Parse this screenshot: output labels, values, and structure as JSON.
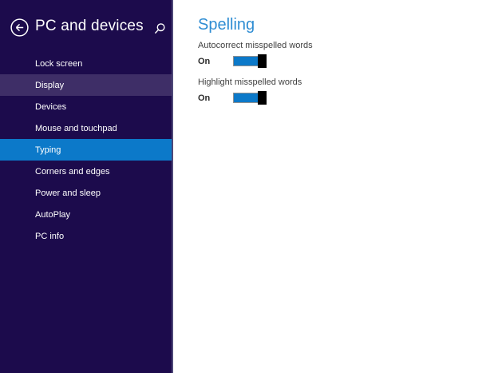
{
  "sidebar": {
    "title": "PC and devices",
    "back_icon": "back-arrow-in-circle",
    "search_icon": "magnifier",
    "items": [
      {
        "label": "Lock screen",
        "state": "normal"
      },
      {
        "label": "Display",
        "state": "hover"
      },
      {
        "label": "Devices",
        "state": "normal"
      },
      {
        "label": "Mouse and touchpad",
        "state": "normal"
      },
      {
        "label": "Typing",
        "state": "selected"
      },
      {
        "label": "Corners and edges",
        "state": "normal"
      },
      {
        "label": "Power and sleep",
        "state": "normal"
      },
      {
        "label": "AutoPlay",
        "state": "normal"
      },
      {
        "label": "PC info",
        "state": "normal"
      }
    ]
  },
  "main": {
    "section_title": "Spelling",
    "settings": [
      {
        "label": "Autocorrect misspelled words",
        "value": "On",
        "toggle_on": true
      },
      {
        "label": "Highlight misspelled words",
        "value": "On",
        "toggle_on": true
      }
    ]
  },
  "colors": {
    "sidebar_bg": "#1c0b4c",
    "sidebar_hover_bg": "#3e2e67",
    "selected_item_bg": "#0c79c9",
    "section_title_blue": "#2f8dd3",
    "toggle_fill": "#0c79c9",
    "toggle_thumb": "#000000",
    "content_bg": "#ffffff"
  }
}
